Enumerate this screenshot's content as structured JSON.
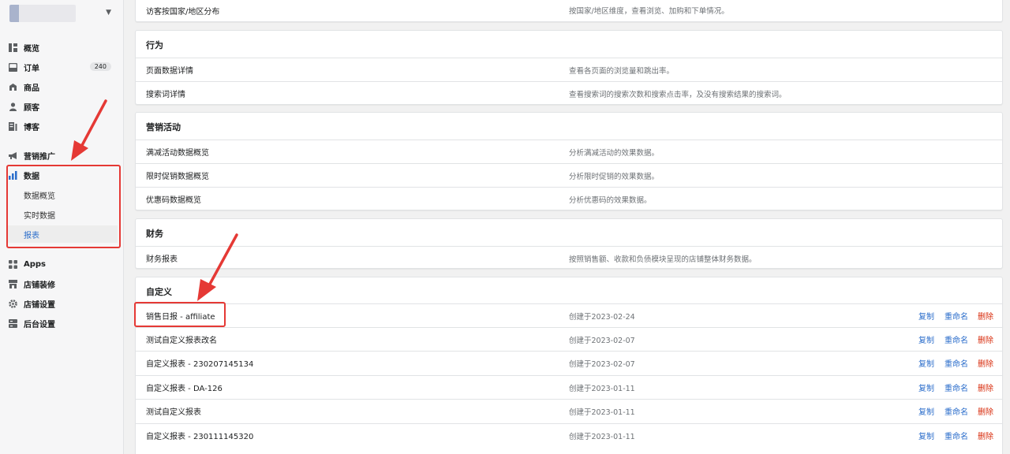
{
  "sidebar": {
    "items": [
      {
        "label": "概览",
        "icon": "overview-icon"
      },
      {
        "label": "订单",
        "icon": "orders-icon",
        "count": "240"
      },
      {
        "label": "商品",
        "icon": "products-icon"
      },
      {
        "label": "顾客",
        "icon": "customers-icon"
      },
      {
        "label": "博客",
        "icon": "blog-icon"
      },
      {
        "label": "营销推广",
        "icon": "marketing-icon"
      },
      {
        "label": "数据",
        "icon": "analytics-icon"
      },
      {
        "label": "Apps",
        "icon": "apps-icon"
      },
      {
        "label": "店铺装修",
        "icon": "store-design-icon"
      },
      {
        "label": "店铺设置",
        "icon": "settings-icon"
      },
      {
        "label": "后台设置",
        "icon": "admin-settings-icon"
      }
    ],
    "sub_items": [
      {
        "label": "数据概览"
      },
      {
        "label": "实时数据"
      },
      {
        "label": "报表"
      }
    ]
  },
  "main": {
    "top_row": {
      "name": "访客按国家/地区分布",
      "desc": "按国家/地区维度，查看浏览、加购和下单情况。"
    },
    "sections": [
      {
        "title": "行为",
        "rows": [
          {
            "name": "页面数据详情",
            "desc": "查看各页面的浏览量和跳出率。"
          },
          {
            "name": "搜索词详情",
            "desc": "查看搜索词的搜索次数和搜索点击率，及没有搜索结果的搜索词。"
          }
        ]
      },
      {
        "title": "营销活动",
        "rows": [
          {
            "name": "满减活动数据概览",
            "desc": "分析满减活动的效果数据。"
          },
          {
            "name": "限时促销数据概览",
            "desc": "分析限时促销的效果数据。"
          },
          {
            "name": "优惠码数据概览",
            "desc": "分析优惠码的效果数据。"
          }
        ]
      },
      {
        "title": "财务",
        "rows": [
          {
            "name": "财务报表",
            "desc": "按照销售额、收款和负债模块呈现的店铺整体财务数据。"
          }
        ]
      }
    ],
    "custom": {
      "title": "自定义",
      "actions": {
        "copy": "复制",
        "rename": "重命名",
        "delete": "删除"
      },
      "rows": [
        {
          "name": "销售日报 - affiliate",
          "desc": "创建于2023-02-24"
        },
        {
          "name": "测试自定义报表改名",
          "desc": "创建于2023-02-07"
        },
        {
          "name": "自定义报表 - 230207145134",
          "desc": "创建于2023-02-07"
        },
        {
          "name": "自定义报表 - DA-126",
          "desc": "创建于2023-01-11"
        },
        {
          "name": "测试自定义报表",
          "desc": "创建于2023-01-11"
        },
        {
          "name": "自定义报表 - 230111145320",
          "desc": "创建于2023-01-11"
        }
      ]
    }
  },
  "colors": {
    "accent": "#2c6ecb",
    "danger": "#d82c0d",
    "annotation": "#e53935"
  }
}
